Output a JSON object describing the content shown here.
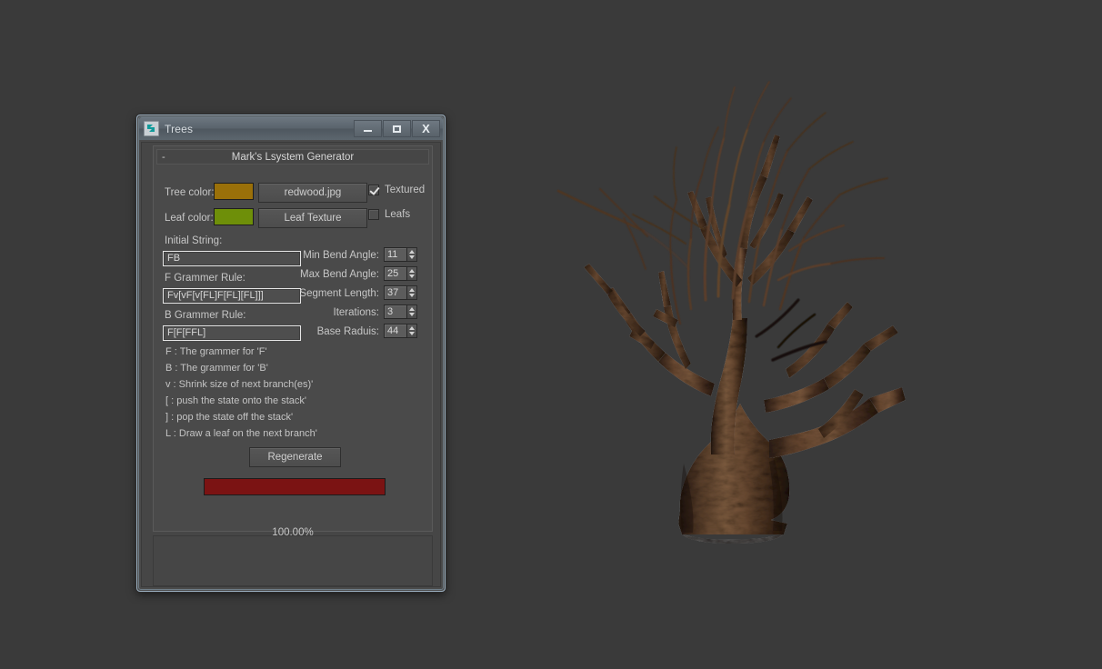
{
  "viewport": {
    "background_color": "#3a3a3a",
    "render_label": "procedural-tree-render",
    "tree_trunk_color": "#4a3426",
    "tree_branch_color": "#6b4a33"
  },
  "window": {
    "title": "Trees",
    "icon": "app-icon",
    "controls": {
      "minimize": "–",
      "maximize": "□",
      "close": "X"
    }
  },
  "rollout": {
    "collapse_glyph": "-",
    "title": "Mark's Lsystem Generator"
  },
  "colors": {
    "tree_color_label": "Tree color:",
    "tree_color_value": "#9a7009",
    "leaf_color_label": "Leaf color:",
    "leaf_color_value": "#6e8f09"
  },
  "texture_buttons": {
    "tree_texture": "redwood.jpg",
    "leaf_texture": "Leaf Texture"
  },
  "checkboxes": [
    {
      "label": "Textured",
      "checked": true
    },
    {
      "label": "Leafs",
      "checked": false
    }
  ],
  "fields": {
    "initial_string_label": "Initial String:",
    "initial_string_value": "FB",
    "f_rule_label": "F Grammer Rule:",
    "f_rule_value": "Fv[vF[v[FL]F[FL][FL]]]",
    "b_rule_label": "B Grammer Rule:",
    "b_rule_value": "F[F[FFL]"
  },
  "spinners": [
    {
      "label": "Min Bend Angle:",
      "value": "11"
    },
    {
      "label": "Max Bend Angle:",
      "value": "25"
    },
    {
      "label": "Segment Length:",
      "value": "37"
    },
    {
      "label": "Iterations:",
      "value": "3"
    },
    {
      "label": "Base Raduis:",
      "value": "44"
    }
  ],
  "legend": [
    "F : The grammer for 'F'",
    "B : The grammer for 'B'",
    "v : Shrink size of next branch(es)'",
    "[ : push the state onto the stack'",
    "] : pop the state off the stack'",
    "L : Draw a leaf on the next branch'"
  ],
  "actions": {
    "regenerate_label": "Regenerate"
  },
  "progress": {
    "percent": 100,
    "percent_text": "100.00%",
    "bar_color": "#7b1313"
  }
}
